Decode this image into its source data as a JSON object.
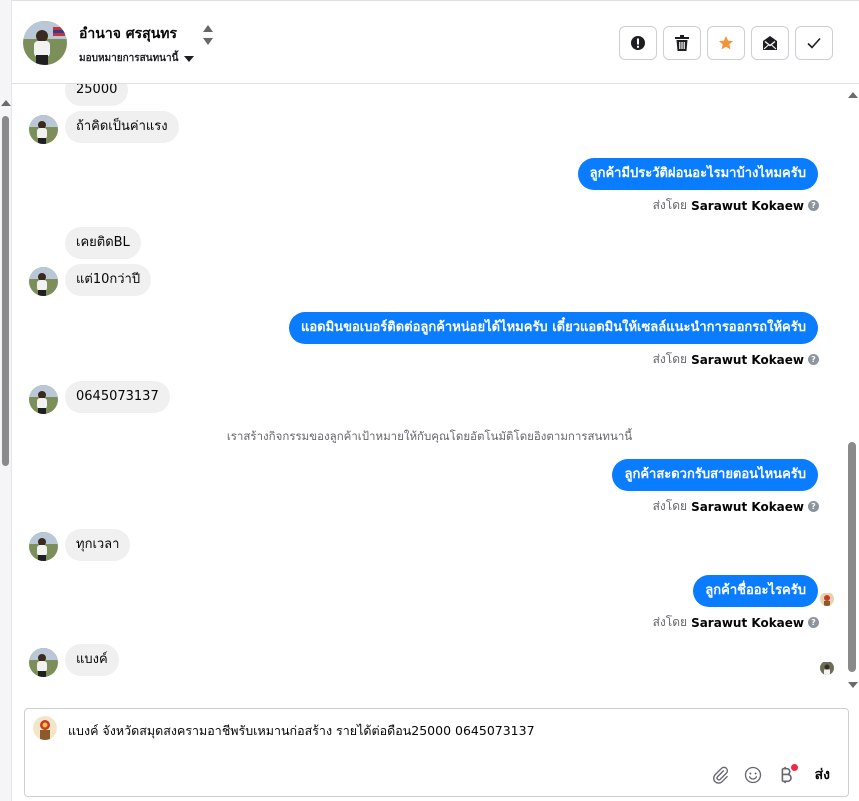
{
  "header": {
    "contact_name": "อำนาจ ศรสุนทร",
    "assign_label": "มอบหมายการสนทนานี้",
    "actions": [
      {
        "name": "report-icon"
      },
      {
        "name": "trash-icon"
      },
      {
        "name": "star-icon",
        "color": "#f7923a"
      },
      {
        "name": "mark-unread-icon"
      },
      {
        "name": "check-icon"
      }
    ]
  },
  "messages": {
    "m1": "25000",
    "m2": "ถ้าคิดเป็นค่าแรง",
    "m3": "ลูกค้ามีประวัติผ่อนอะไรมาบ้างไหมครับ",
    "m4": "เคยติดBL",
    "m5": "แต่10กว่าปี",
    "m6": "แอดมินขอเบอร์ติดต่อลูกค้าหน่อยได้ไหมครับ เดี๋ยวแอดมินให้เซลล์แนะนำการออกรถให้ครับ",
    "m7": "0645073137",
    "system": "เราสร้างกิจกรรมของลูกค้าเป้าหมายให้กับคุณโดยอัตโนมัติโดยอิงตามการสนทนานี้",
    "m8": "ลูกค้าสะดวกรับสายตอนไหนครับ",
    "m9": "ทุกเวลา",
    "m10": "ลูกค้าชื่ออะไรครับ",
    "m11": "แบงค์"
  },
  "sent_by": {
    "prefix": "ส่งโดย",
    "name": "Sarawut Kokaew"
  },
  "composer": {
    "text": "แบงค์ จังหวัดสมุดสงครามอาชีพรับเหมานก่อสร้าง รายได้ต่อดือน25000 0645073137",
    "send_label": "ส่ง"
  },
  "colors": {
    "outgoing_bubble": "#0a7cff",
    "incoming_bubble": "#f0f0f0"
  }
}
